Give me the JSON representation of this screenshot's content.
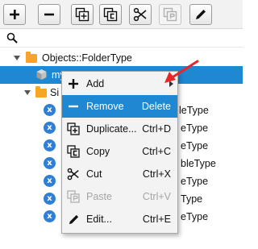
{
  "toolbar": {
    "buttons": [
      {
        "name": "add-button",
        "icon": "plus-icon"
      },
      {
        "name": "remove-button",
        "icon": "minus-icon"
      },
      {
        "name": "duplicate-button",
        "icon": "duplicate-icon"
      },
      {
        "name": "copy-button",
        "icon": "copy-icon"
      },
      {
        "name": "cut-button",
        "icon": "scissors-icon"
      },
      {
        "name": "paste-button",
        "icon": "paste-icon",
        "disabled": true
      },
      {
        "name": "edit-button",
        "icon": "pencil-icon"
      }
    ]
  },
  "search": {
    "icon": "search-icon",
    "value": "",
    "placeholder": ""
  },
  "tree": {
    "root_label": "Objects::FolderType",
    "selected_item_label": "my",
    "subfolder_label": "Si",
    "children_suffixes": [
      "leType",
      "eType",
      "eType",
      "bleType",
      "eType",
      "Type",
      "eType"
    ]
  },
  "context_menu": {
    "items": [
      {
        "label": "Add",
        "shortcut": "",
        "icon": "plus-icon",
        "submenu": true,
        "highlighted": false,
        "disabled": false
      },
      {
        "label": "Remove",
        "shortcut": "Delete",
        "icon": "minus-icon",
        "submenu": false,
        "highlighted": true,
        "disabled": false
      },
      {
        "label": "Duplicate...",
        "shortcut": "Ctrl+D",
        "icon": "duplicate-icon",
        "submenu": false,
        "highlighted": false,
        "disabled": false
      },
      {
        "label": "Copy",
        "shortcut": "Ctrl+C",
        "icon": "copy-icon",
        "submenu": false,
        "highlighted": false,
        "disabled": false
      },
      {
        "label": "Cut",
        "shortcut": "Ctrl+X",
        "icon": "scissors-icon",
        "submenu": false,
        "highlighted": false,
        "disabled": false
      },
      {
        "label": "Paste",
        "shortcut": "Ctrl+V",
        "icon": "paste-icon",
        "submenu": false,
        "highlighted": false,
        "disabled": true
      },
      {
        "label": "Edit...",
        "shortcut": "Ctrl+E",
        "icon": "pencil-icon",
        "submenu": false,
        "highlighted": false,
        "disabled": false
      }
    ]
  },
  "colors": {
    "selection": "#1e88d2",
    "folder": "#f6a623",
    "type_icon": "#2f7fd6",
    "annotation_arrow": "#e8262a"
  }
}
